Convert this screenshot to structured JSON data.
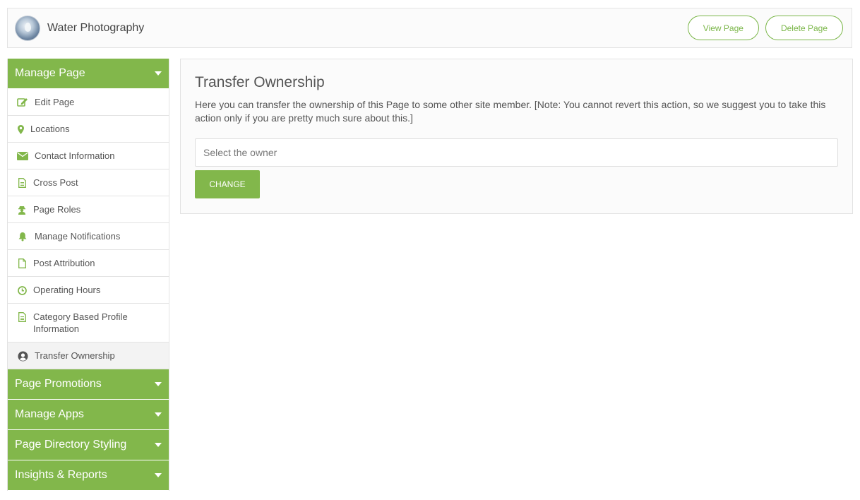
{
  "header": {
    "title": "Water Photography",
    "view_label": "View Page",
    "delete_label": "Delete Page"
  },
  "sidebar": {
    "manage_page": {
      "label": "Manage Page",
      "items": [
        {
          "label": "Edit Page",
          "icon": "edit-icon"
        },
        {
          "label": "Locations",
          "icon": "map-marker-icon"
        },
        {
          "label": "Contact Information",
          "icon": "envelope-icon"
        },
        {
          "label": "Cross Post",
          "icon": "document-icon"
        },
        {
          "label": "Page Roles",
          "icon": "user-secret-icon"
        },
        {
          "label": "Manage Notifications",
          "icon": "bell-icon"
        },
        {
          "label": "Post Attribution",
          "icon": "file-icon"
        },
        {
          "label": "Operating Hours",
          "icon": "clock-icon"
        },
        {
          "label": "Category Based Profile Information",
          "icon": "document-icon"
        },
        {
          "label": "Transfer Ownership",
          "icon": "user-circle-icon"
        }
      ]
    },
    "sections": [
      {
        "label": "Page Promotions"
      },
      {
        "label": "Manage Apps"
      },
      {
        "label": "Page Directory Styling"
      },
      {
        "label": "Insights & Reports"
      }
    ]
  },
  "main": {
    "title": "Transfer Ownership",
    "description": "Here you can transfer the ownership of this Page to some other site member. [Note: You cannot revert this action, so we suggest you to take this action only if you are pretty much sure about this.]",
    "owner_placeholder": "Select the owner",
    "change_label": "CHANGE"
  },
  "colors": {
    "accent": "#82b74b",
    "outline_accent": "#7ab648"
  }
}
